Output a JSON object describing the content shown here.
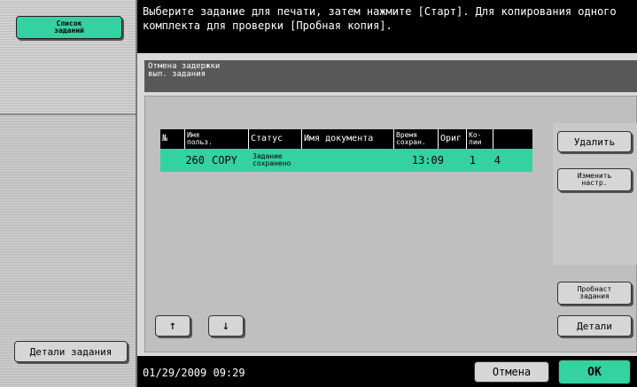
{
  "left": {
    "job_list_label": "Список\nзаданий",
    "job_details_label": "Детали задания"
  },
  "header": {
    "message": "Выберите задание для печати, затем нажмите [Старт]. Для копирования одного комплекта для проверки [Пробная копия]."
  },
  "main": {
    "subtitle": "Отмена задержки\nвып. задания",
    "table": {
      "columns": [
        "№",
        "Имя\nпольз.",
        "Статус",
        "Имя документа",
        "Время\nсохран.",
        "Ориг",
        "Ко-\nпии"
      ],
      "rows": [
        {
          "no": "260",
          "user": "COPY",
          "status": "Задание\nсохранено",
          "doc": "",
          "time": "13:09",
          "orig": "1",
          "copies": "4"
        }
      ]
    },
    "buttons": {
      "delete": "Удалить",
      "change_settings": "Изменить\nнастр.",
      "proof_print": "Пробнаст\nзадания",
      "details": "Детали"
    },
    "arrows": {
      "up": "↑",
      "down": "↓"
    }
  },
  "bottom": {
    "datetime": "01/29/2009   09:29",
    "cancel": "Отмена",
    "ok": "OK"
  },
  "colors": {
    "accent": "#34d2a0",
    "header_bg": "#000000"
  }
}
